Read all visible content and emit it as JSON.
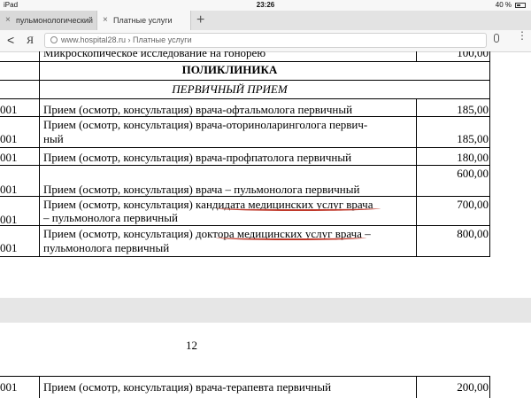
{
  "status": {
    "left": "iPad",
    "time": "23:26",
    "battery": "40 %"
  },
  "tabs": [
    {
      "label": "пульмонологический"
    },
    {
      "label": "Платные услуги"
    }
  ],
  "new_tab": "+",
  "address": {
    "back": "<",
    "yandex": "Я",
    "url": "www.hospital28.ru › Платные услуги",
    "menu": "⋮"
  },
  "table1": {
    "top_desc": "Микроскопическое исследование на гонорею",
    "top_price": "100,00",
    "section": "ПОЛИКЛИНИКА",
    "subsection": "ПЕРВИЧНЫЙ ПРИЕМ",
    "rows": [
      {
        "code": "001",
        "desc": "Прием (осмотр, консультация) врача-офтальмолога первичный",
        "price": "185,00"
      },
      {
        "code": "001",
        "desc1": "Прием (осмотр, консультация) врача-оториноларинголога первич-",
        "desc2": "ный",
        "price": "185,00"
      },
      {
        "code": "001",
        "desc": "Прием (осмотр, консультация) врача-профпатолога первичный",
        "price": "180,00"
      },
      {
        "code": "001",
        "desc": "Прием (осмотр, консультация) врача – пульмонолога первичный",
        "price": "600,00"
      },
      {
        "code": "001",
        "desc1": "Прием (осмотр, консультация) кандидата медицинских услуг врача",
        "desc2": "– пульмонолога первичный",
        "price": "700,00"
      },
      {
        "code": "001",
        "desc1": "Прием (осмотр, консультация) доктора медицинских услуг врача –",
        "desc2": "пульмонолога первичный",
        "price": "800,00"
      }
    ]
  },
  "page_number": "12",
  "table2": {
    "row": {
      "code": "001",
      "desc": "Прием (осмотр, консультация) врача-терапевта первичный",
      "price": "200,00"
    }
  }
}
